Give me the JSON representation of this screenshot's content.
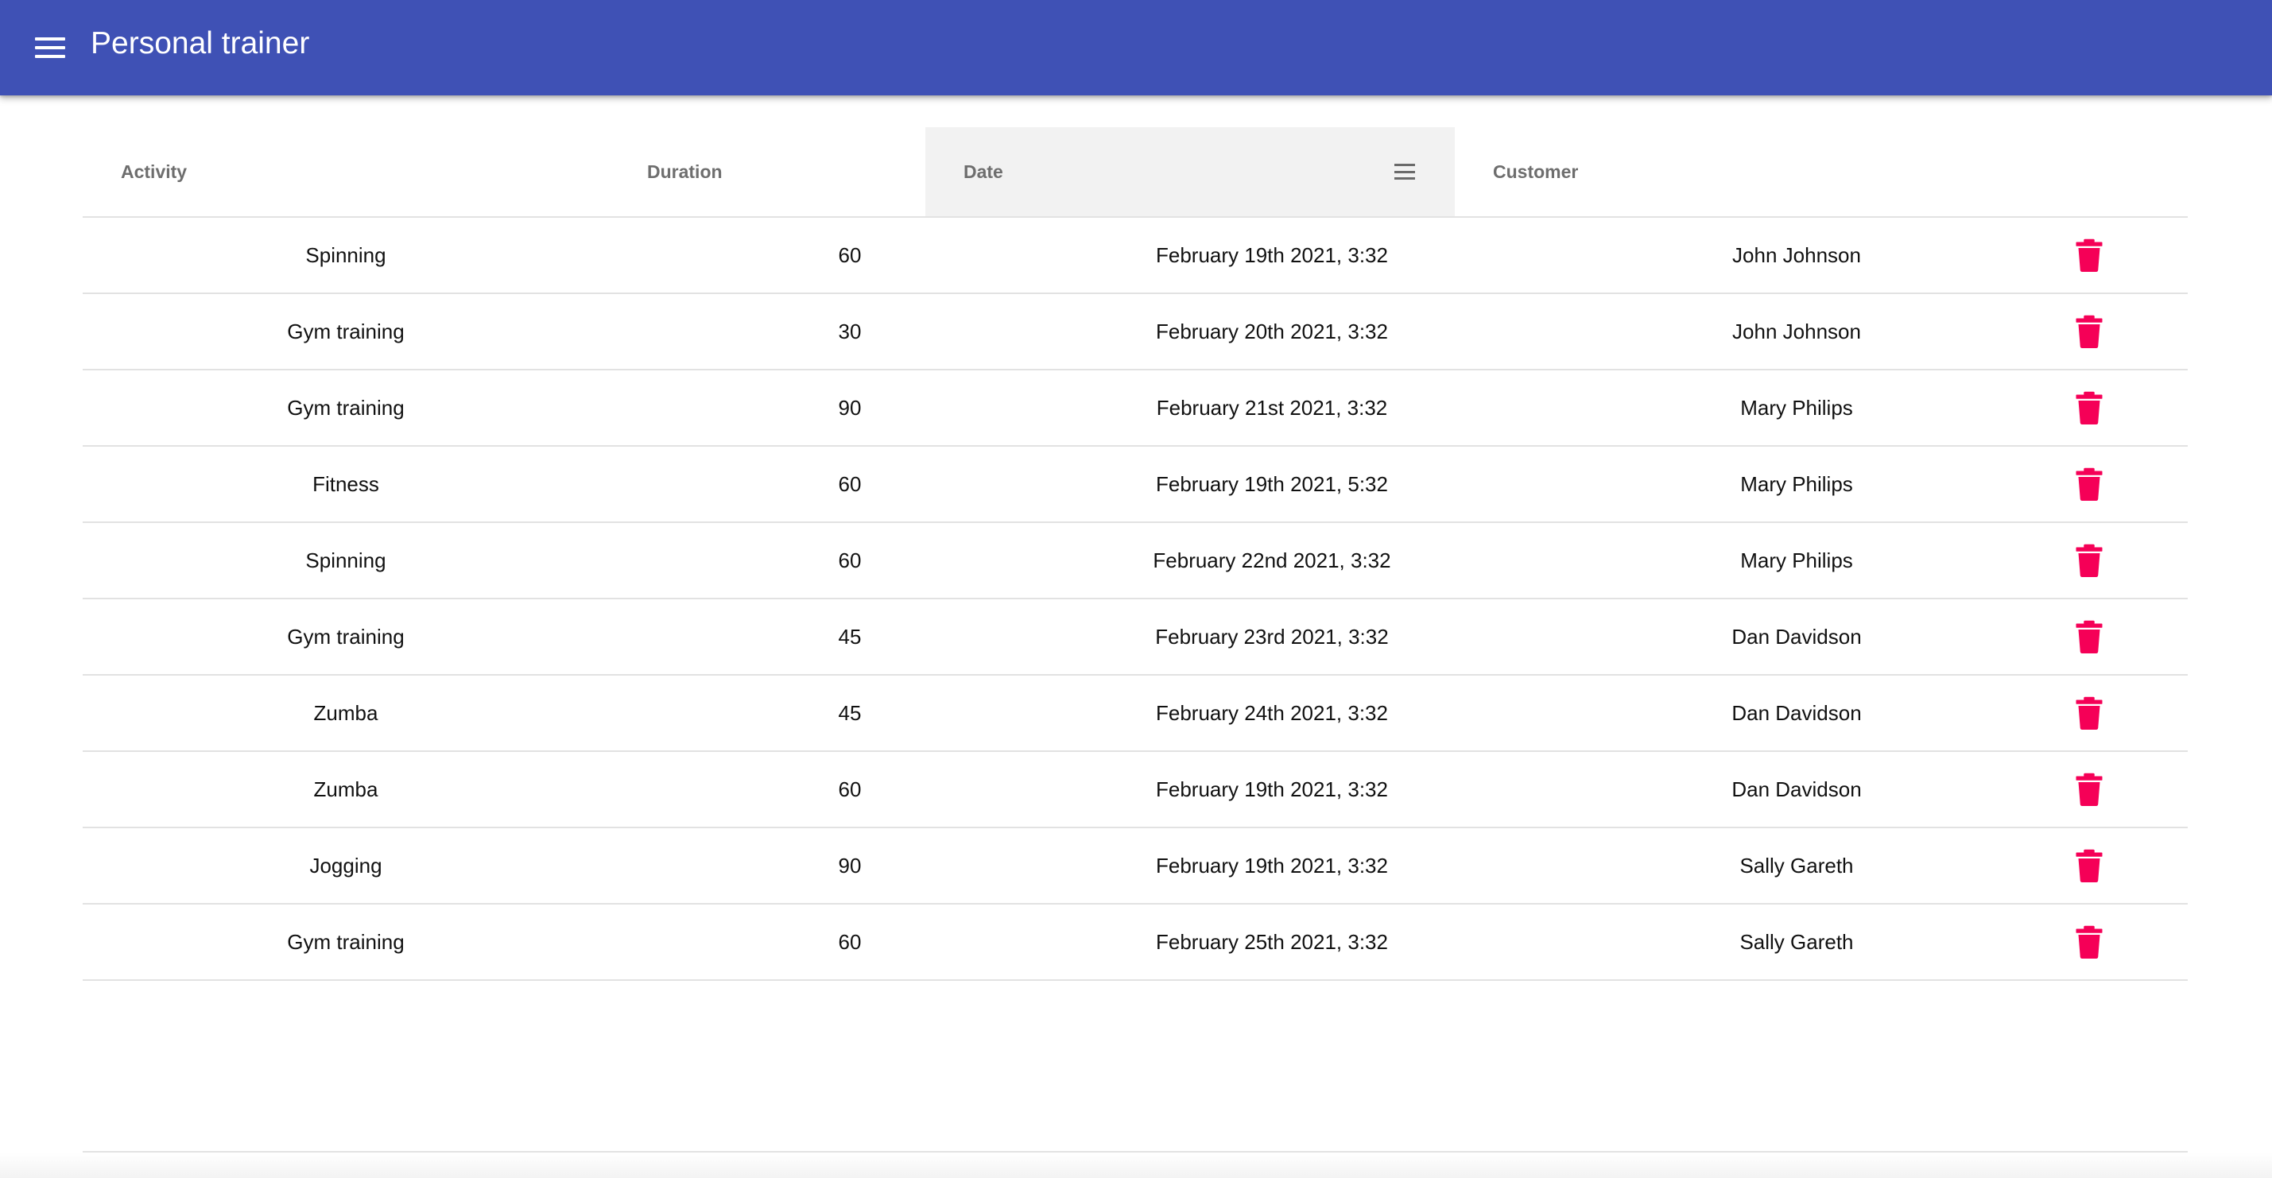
{
  "app": {
    "title": "Personal trainer",
    "colors": {
      "primary": "#3f51b5",
      "delete": "#f50057"
    },
    "menu_icon": "hamburger-menu-icon"
  },
  "table": {
    "columns": [
      {
        "key": "activity",
        "label": "Activity"
      },
      {
        "key": "duration",
        "label": "Duration"
      },
      {
        "key": "date",
        "label": "Date",
        "active": true,
        "menu_icon": "column-menu-icon"
      },
      {
        "key": "customer",
        "label": "Customer"
      }
    ],
    "rows": [
      {
        "activity": "Spinning",
        "duration": "60",
        "date": "February 19th 2021, 3:32",
        "customer": "John Johnson"
      },
      {
        "activity": "Gym training",
        "duration": "30",
        "date": "February 20th 2021, 3:32",
        "customer": "John Johnson"
      },
      {
        "activity": "Gym training",
        "duration": "90",
        "date": "February 21st 2021, 3:32",
        "customer": "Mary Philips"
      },
      {
        "activity": "Fitness",
        "duration": "60",
        "date": "February 19th 2021, 5:32",
        "customer": "Mary Philips"
      },
      {
        "activity": "Spinning",
        "duration": "60",
        "date": "February 22nd 2021, 3:32",
        "customer": "Mary Philips"
      },
      {
        "activity": "Gym training",
        "duration": "45",
        "date": "February 23rd 2021, 3:32",
        "customer": "Dan Davidson"
      },
      {
        "activity": "Zumba",
        "duration": "45",
        "date": "February 24th 2021, 3:32",
        "customer": "Dan Davidson"
      },
      {
        "activity": "Zumba",
        "duration": "60",
        "date": "February 19th 2021, 3:32",
        "customer": "Dan Davidson"
      },
      {
        "activity": "Jogging",
        "duration": "90",
        "date": "February 19th 2021, 3:32",
        "customer": "Sally Gareth"
      },
      {
        "activity": "Gym training",
        "duration": "60",
        "date": "February 25th 2021, 3:32",
        "customer": "Sally Gareth"
      }
    ],
    "row_action_icon": "trash-icon"
  }
}
